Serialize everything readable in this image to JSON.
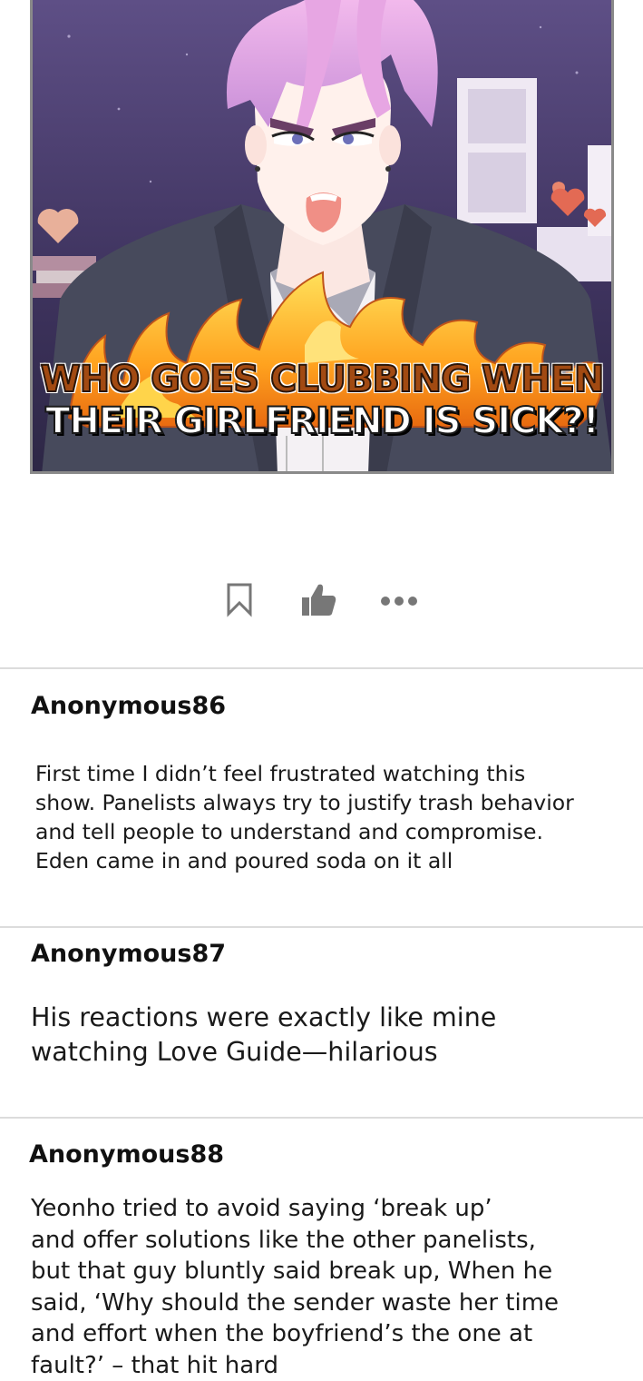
{
  "panel": {
    "caption_line1": "WHO GOES CLUBBING WHEN",
    "caption_line2": "THEIR GIRLFRIEND IS SICK?!"
  },
  "actions": [
    {
      "name": "bookmark-icon"
    },
    {
      "name": "thumbs-up-icon"
    },
    {
      "name": "more-options-icon"
    }
  ],
  "comments": [
    {
      "user": "Anonymous86",
      "text": "First time I didn’t feel frustrated watching this\nshow. Panelists always try to justify trash behavior\nand tell people to understand and compromise.\nEden came in and poured soda on it all"
    },
    {
      "user": "Anonymous87",
      "text": "His reactions were exactly like mine\nwatching Love Guide—hilarious"
    },
    {
      "user": "Anonymous88",
      "text": "Yeonho tried to avoid saying ‘break up’\nand offer solutions like the other panelists,\nbut that guy bluntly said break up, When he\nsaid, ‘Why should the sender waste her time\nand effort when the boyfriend’s the one at\nfault?’ – that hit hard"
    }
  ]
}
